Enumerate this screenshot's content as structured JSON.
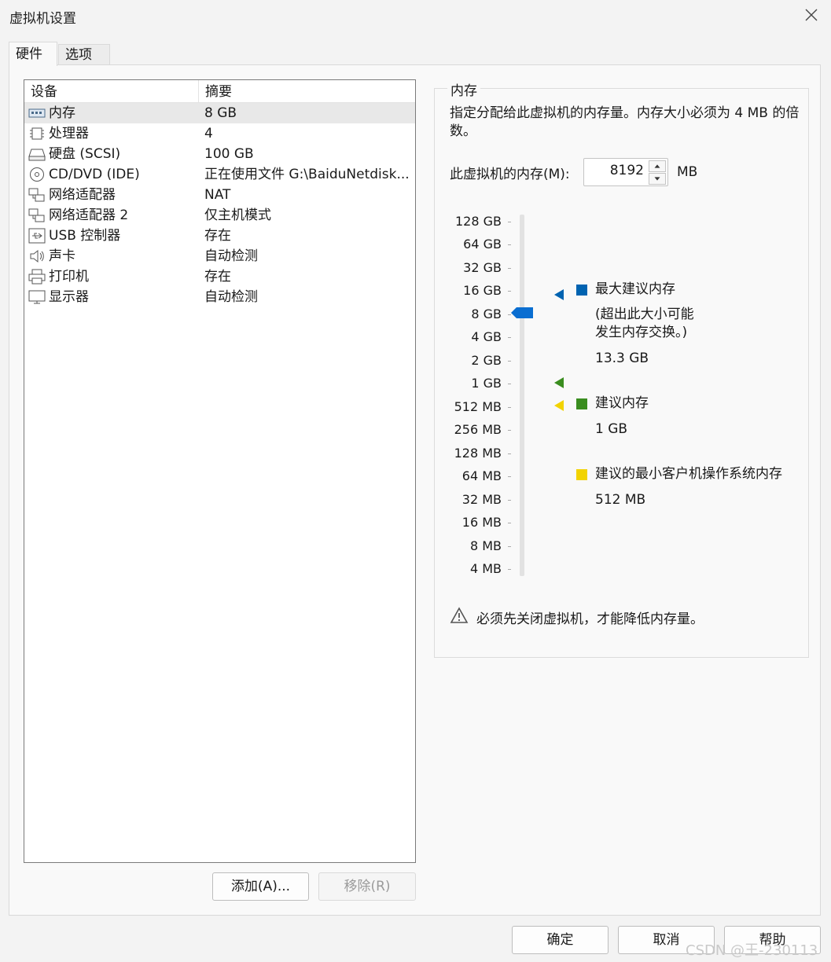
{
  "window": {
    "title": "虚拟机设置"
  },
  "tabs": [
    {
      "label": "硬件"
    },
    {
      "label": "选项"
    }
  ],
  "device_table": {
    "headers": [
      "设备",
      "摘要"
    ],
    "rows": [
      {
        "name": "内存",
        "summary": "8 GB",
        "icon": "memory-icon"
      },
      {
        "name": "处理器",
        "summary": "4",
        "icon": "processor-icon"
      },
      {
        "name": "硬盘 (SCSI)",
        "summary": "100 GB",
        "icon": "hard-disk-icon"
      },
      {
        "name": "CD/DVD (IDE)",
        "summary": "正在使用文件 G:\\BaiduNetdisk...",
        "icon": "cd-dvd-icon"
      },
      {
        "name": "网络适配器",
        "summary": "NAT",
        "icon": "network-adapter-icon"
      },
      {
        "name": "网络适配器 2",
        "summary": "仅主机模式",
        "icon": "network-adapter-icon"
      },
      {
        "name": "USB 控制器",
        "summary": "存在",
        "icon": "usb-icon"
      },
      {
        "name": "声卡",
        "summary": "自动检测",
        "icon": "sound-card-icon"
      },
      {
        "name": "打印机",
        "summary": "存在",
        "icon": "printer-icon"
      },
      {
        "name": "显示器",
        "summary": "自动检测",
        "icon": "display-icon"
      }
    ]
  },
  "list_buttons": {
    "add": "添加(A)...",
    "remove": "移除(R)"
  },
  "memory": {
    "group_title": "内存",
    "description": "指定分配给此虚拟机的内存量。内存大小必须为 4 MB 的倍数。",
    "field_label": "此虚拟机的内存(M):",
    "value": "8192",
    "unit": "MB",
    "scale_labels": [
      "128 GB",
      "64 GB",
      "32 GB",
      "16 GB",
      "8 GB",
      "4 GB",
      "2 GB",
      "1 GB",
      "512 MB",
      "256 MB",
      "128 MB",
      "64 MB",
      "32 MB",
      "16 MB",
      "8 MB",
      "4 MB"
    ],
    "slider_value": "8 GB",
    "legend": {
      "max": {
        "label": "最大建议内存",
        "note_line1": "(超出此大小可能",
        "note_line2": "发生内存交换。)",
        "value": "13.3 GB",
        "color": "#0063b1"
      },
      "recommended": {
        "label": "建议内存",
        "value": "1 GB",
        "color": "#3a8d1f"
      },
      "min_guest": {
        "label": "建议的最小客户机操作系统内存",
        "value": "512 MB",
        "color": "#f2d300"
      }
    },
    "warning": "必须先关闭虚拟机，才能降低内存量。"
  },
  "footer": {
    "ok": "确定",
    "cancel": "取消",
    "help": "帮助"
  },
  "watermark": "CSDN @王-230113"
}
